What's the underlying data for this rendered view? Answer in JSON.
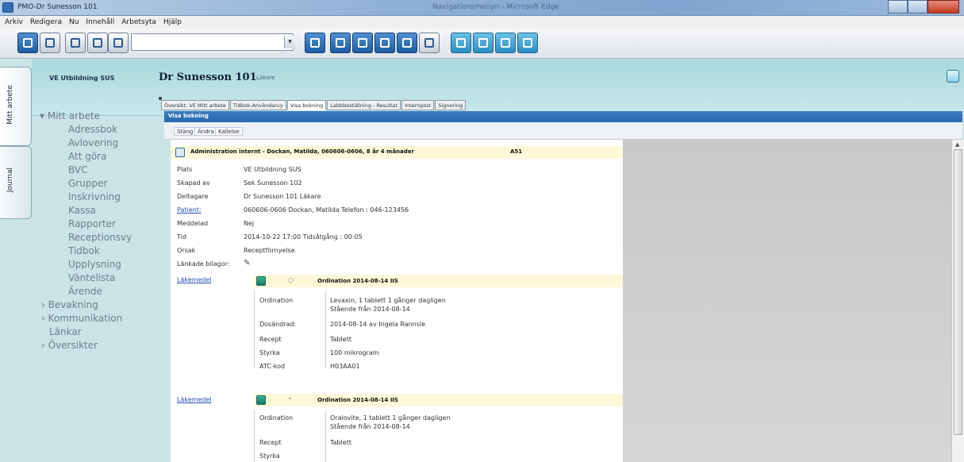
{
  "window": {
    "title": "PMO-Dr Sunesson 101",
    "center_text": "Navigationsmenyn - Microsoft Edge"
  },
  "menu": [
    "Arkiv",
    "Redigera",
    "Nu",
    "Innehåll",
    "Arbetsyta",
    "Hjälp"
  ],
  "header": {
    "unit": "VE Utbildning SUS",
    "doctor": "Dr Sunesson 101",
    "role": "Läkare"
  },
  "side_tabs": [
    "Mitt arbete",
    "Journal"
  ],
  "nav": {
    "mitt_arbete": "Mitt arbete",
    "items": [
      "Adressbok",
      "Avlovering",
      "Att göra",
      "BVC",
      "Grupper",
      "Inskrivning",
      "Kassa",
      "Rapporter",
      "Receptionsvy",
      "Tidbok",
      "Upplysning",
      "Väntelista",
      "Ärende"
    ],
    "bevakning": "Bevakning",
    "kommunikation": "Kommunikation",
    "lankar": "Länkar",
    "oversikter": "Översikter"
  },
  "doc_tabs": [
    "Översikt: VE Mitt arbete",
    "Tidbok-Användarvy",
    "Visa bokning",
    "Labbbeställning - Resultat",
    "Internpost",
    "Signering"
  ],
  "pane": {
    "title": "Visa bokning",
    "buttons": [
      "Stäng",
      "Ändra",
      "Kallelse"
    ]
  },
  "booking": {
    "header": "Administration internt - Dockan, Matilda, 060606-0606, 8 år 4 månader",
    "code": "A51",
    "fields": [
      {
        "label": "Plats",
        "value": "VE Utbildning SUS"
      },
      {
        "label": "Skapad av",
        "value": "Sek Sunesson 102"
      },
      {
        "label": "Deltagare",
        "value": "Dr Sunesson 101 Läkare"
      },
      {
        "label": "Patient:",
        "value": "060606-0606 Dockan, Matilda    Telefon : 046-123456"
      },
      {
        "label": "Meddelad",
        "value": "Nej"
      },
      {
        "label": "Tid",
        "value": "2014-10-22 17:00  Tidsåtgång : 00:05"
      },
      {
        "label": "Orsak",
        "value": "Receptförnyelse."
      },
      {
        "label": "Länkade bilagor:",
        "value": ""
      }
    ]
  },
  "medications": [
    {
      "link": "Läkemedel",
      "bar": "Ordination    2014-08-14    IIS",
      "rows": [
        {
          "label": "Ordination",
          "value": "Levaxin, 1 tablett 1 gånger dagligen"
        },
        {
          "label": "",
          "value": "Stående från 2014-08-14"
        },
        {
          "label": "Dosändrad:",
          "value": "2014-08-14 av Ingela Rannsle"
        },
        {
          "label": "Recept",
          "value": "Tablett"
        },
        {
          "label": "Styrka",
          "value": "100 mikrogram"
        },
        {
          "label": "ATC-kod",
          "value": "H03AA01"
        }
      ]
    },
    {
      "link": "Läkemedel",
      "bar": "Ordination    2014-08-14    IIS",
      "rows": [
        {
          "label": "Ordination",
          "value": "Oralovite, 1 tablett 1 gånger dagligen"
        },
        {
          "label": "",
          "value": "Stående från 2014-08-14"
        },
        {
          "label": "Recept",
          "value": "Tablett"
        },
        {
          "label": "Styrka",
          "value": ""
        }
      ]
    }
  ]
}
